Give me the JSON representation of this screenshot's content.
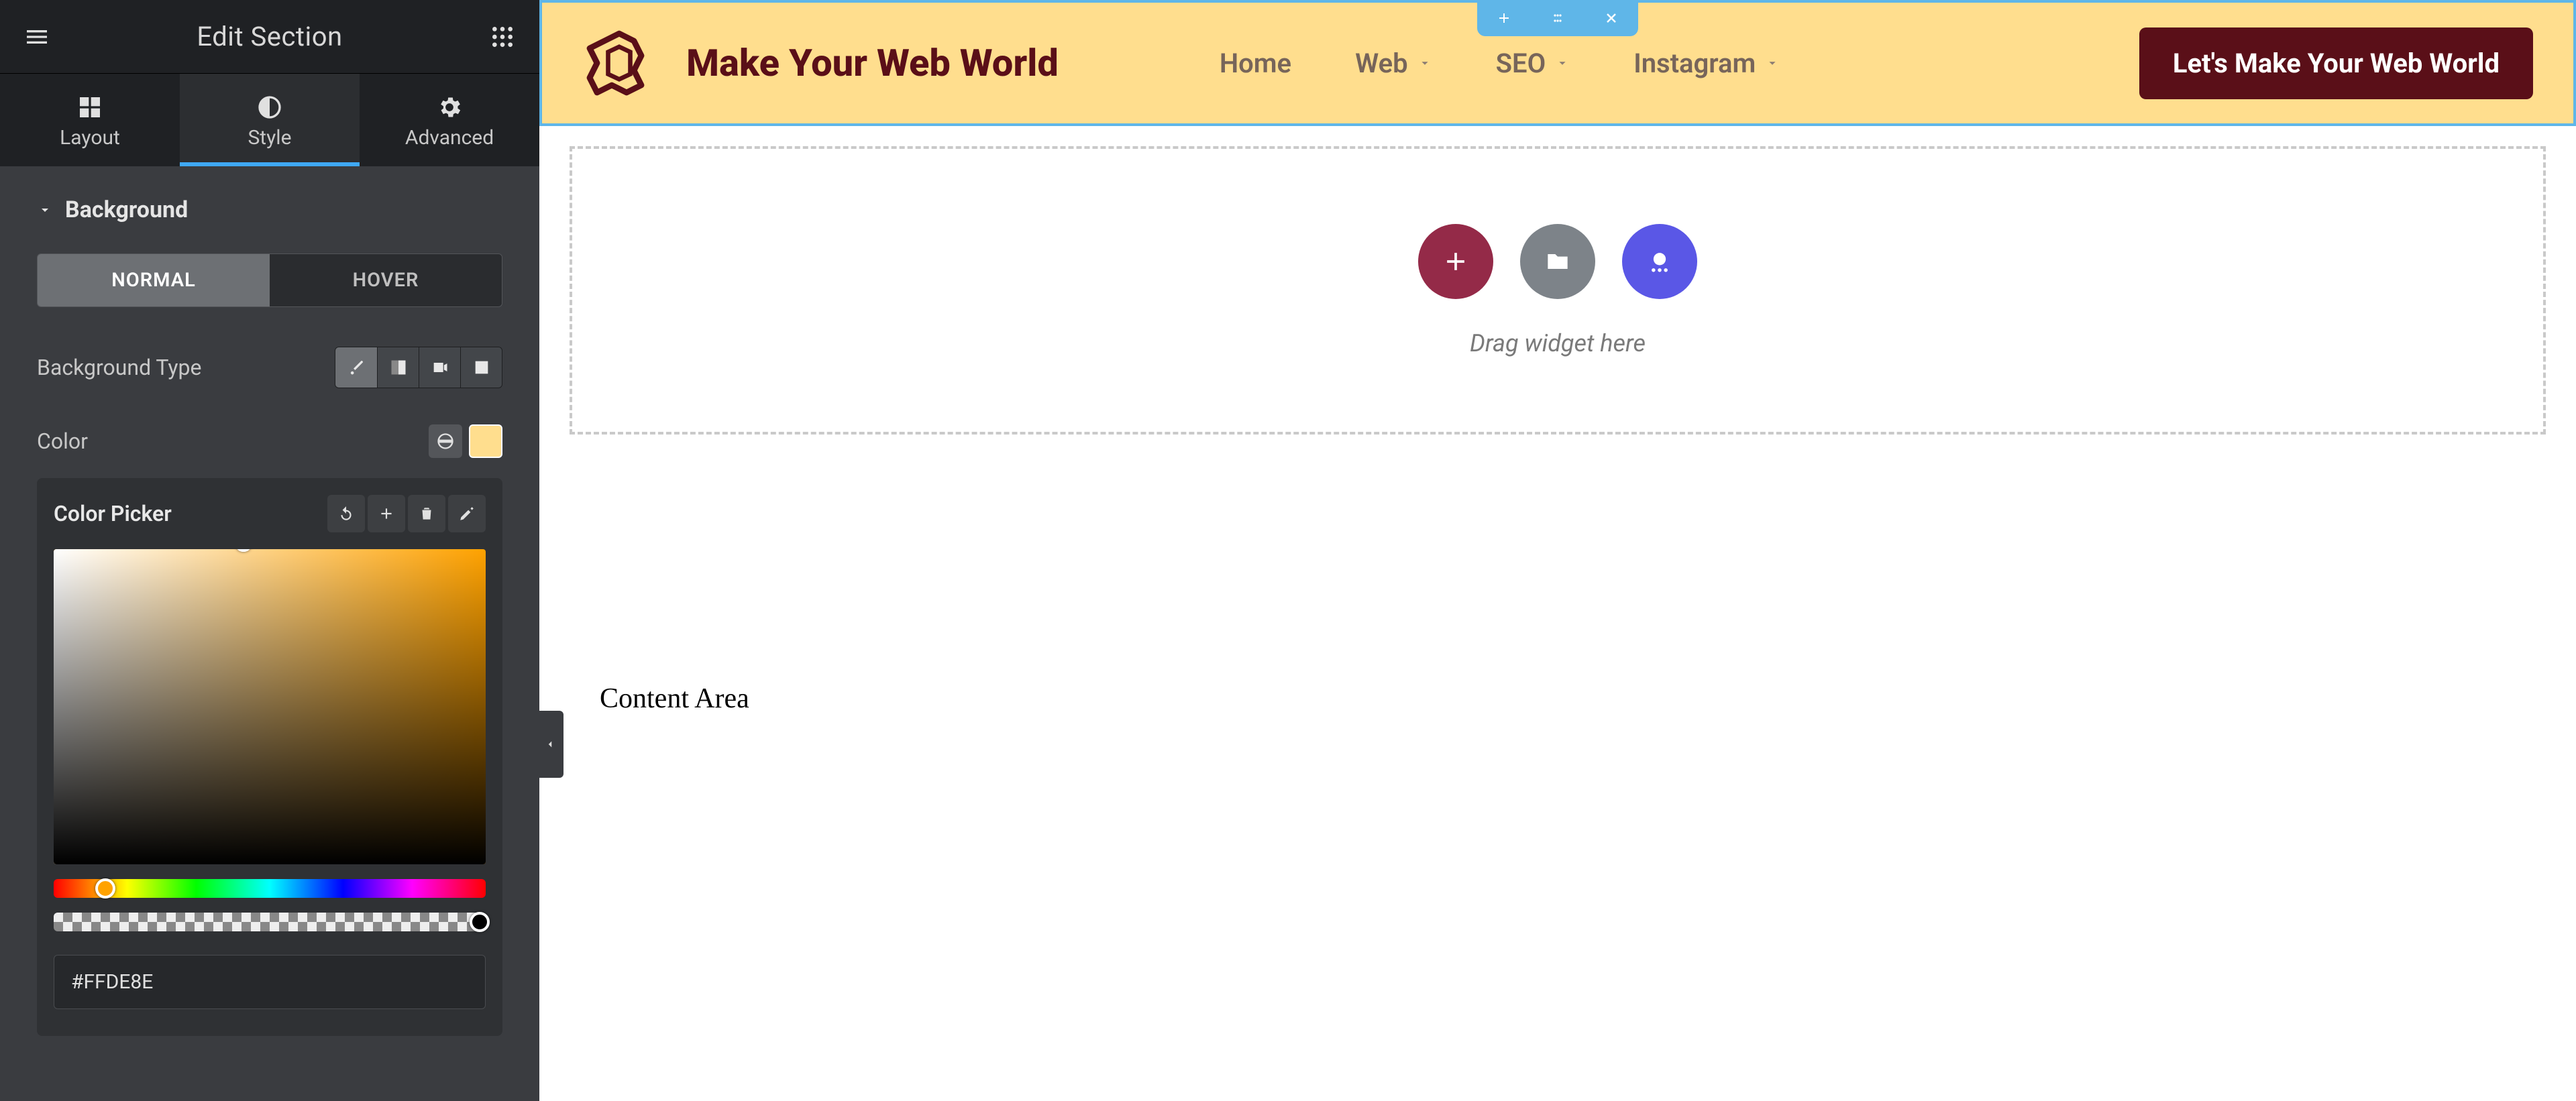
{
  "panel": {
    "title": "Edit Section",
    "tabs": {
      "layout": "Layout",
      "style": "Style",
      "advanced": "Advanced"
    },
    "section_label": "Background",
    "state_tabs": {
      "normal": "NORMAL",
      "hover": "HOVER"
    },
    "bg_type_label": "Background Type",
    "color_label": "Color",
    "swatch_color": "#FFDE8E",
    "picker_title": "Color Picker",
    "hex_value": "#FFDE8E"
  },
  "header": {
    "brand": "Make Your Web World",
    "nav": [
      "Home",
      "Web",
      "SEO",
      "Instagram"
    ],
    "cta": "Let's Make Your Web World"
  },
  "canvas": {
    "drag_hint": "Drag widget here",
    "content_area": "Content Area"
  }
}
